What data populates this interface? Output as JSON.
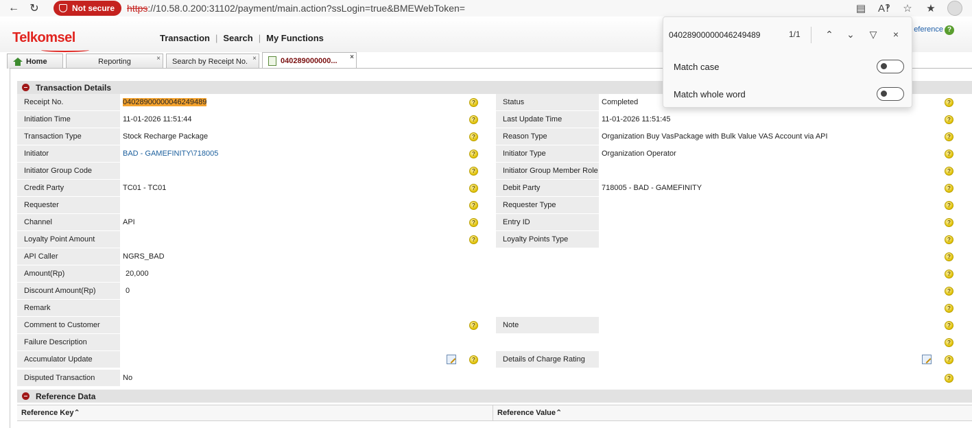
{
  "browser": {
    "security_label": "Not secure",
    "url_scheme": "https",
    "url_rest": "://10.58.0.200:31102/payment/main.action?ssLogin=true&BMEWebToken="
  },
  "header": {
    "logo": "Telkomsel",
    "menu": [
      "Transaction",
      "Search",
      "My Functions"
    ],
    "reference_link": "eference"
  },
  "tabs": [
    {
      "label": "Home"
    },
    {
      "label": "Reporting"
    },
    {
      "label": "Search by Receipt No."
    },
    {
      "label": "040289000000..."
    }
  ],
  "find": {
    "query": "04028900000046249489",
    "count": "1/1",
    "match_case": "Match case",
    "match_whole_word": "Match whole word"
  },
  "transaction": {
    "title": "Transaction Details",
    "rows": [
      {
        "l1": "Receipt No.",
        "v1": "04028900000046249489",
        "l2": "Status",
        "v2": "Completed"
      },
      {
        "l1": "Initiation Time",
        "v1": "11-01-2026 11:51:44",
        "l2": "Last Update Time",
        "v2": "11-01-2026 11:51:45"
      },
      {
        "l1": "Transaction Type",
        "v1": "Stock Recharge Package",
        "l2": "Reason Type",
        "v2": "Organization Buy VasPackage with Bulk Value VAS Account via API"
      },
      {
        "l1": "Initiator",
        "v1": "BAD - GAMEFINITY\\718005",
        "l2": "Initiator Type",
        "v2": "Organization Operator"
      },
      {
        "l1": "Initiator Group Code",
        "v1": "",
        "l2": "Initiator Group Member Role",
        "v2": ""
      },
      {
        "l1": "Credit Party",
        "v1": "TC01 - TC01",
        "l2": "Debit Party",
        "v2": "718005 - BAD - GAMEFINITY"
      },
      {
        "l1": "Requester",
        "v1": "",
        "l2": "Requester Type",
        "v2": ""
      },
      {
        "l1": "Channel",
        "v1": "API",
        "l2": "Entry ID",
        "v2": ""
      },
      {
        "l1": "Loyalty Point Amount",
        "v1": "",
        "l2": "Loyalty Points Type",
        "v2": ""
      },
      {
        "l1": "API Caller",
        "v1": "NGRS_BAD"
      },
      {
        "l1": "Amount(Rp)",
        "v1": "20,000"
      },
      {
        "l1": "Discount Amount(Rp)",
        "v1": "0"
      },
      {
        "l1": "Remark",
        "v1": ""
      },
      {
        "l1": "Comment to Customer",
        "v1": "",
        "l2": "Note",
        "v2": ""
      },
      {
        "l1": "Failure Description",
        "v1": ""
      },
      {
        "l1": "Accumulator Update",
        "v1": "",
        "l2": "Details of Charge Rating",
        "v2": ""
      },
      {
        "l1": "Disputed Transaction",
        "v1": "No"
      }
    ]
  },
  "reference": {
    "title": "Reference Data",
    "col_key": "Reference Key",
    "col_value": "Reference Value"
  }
}
